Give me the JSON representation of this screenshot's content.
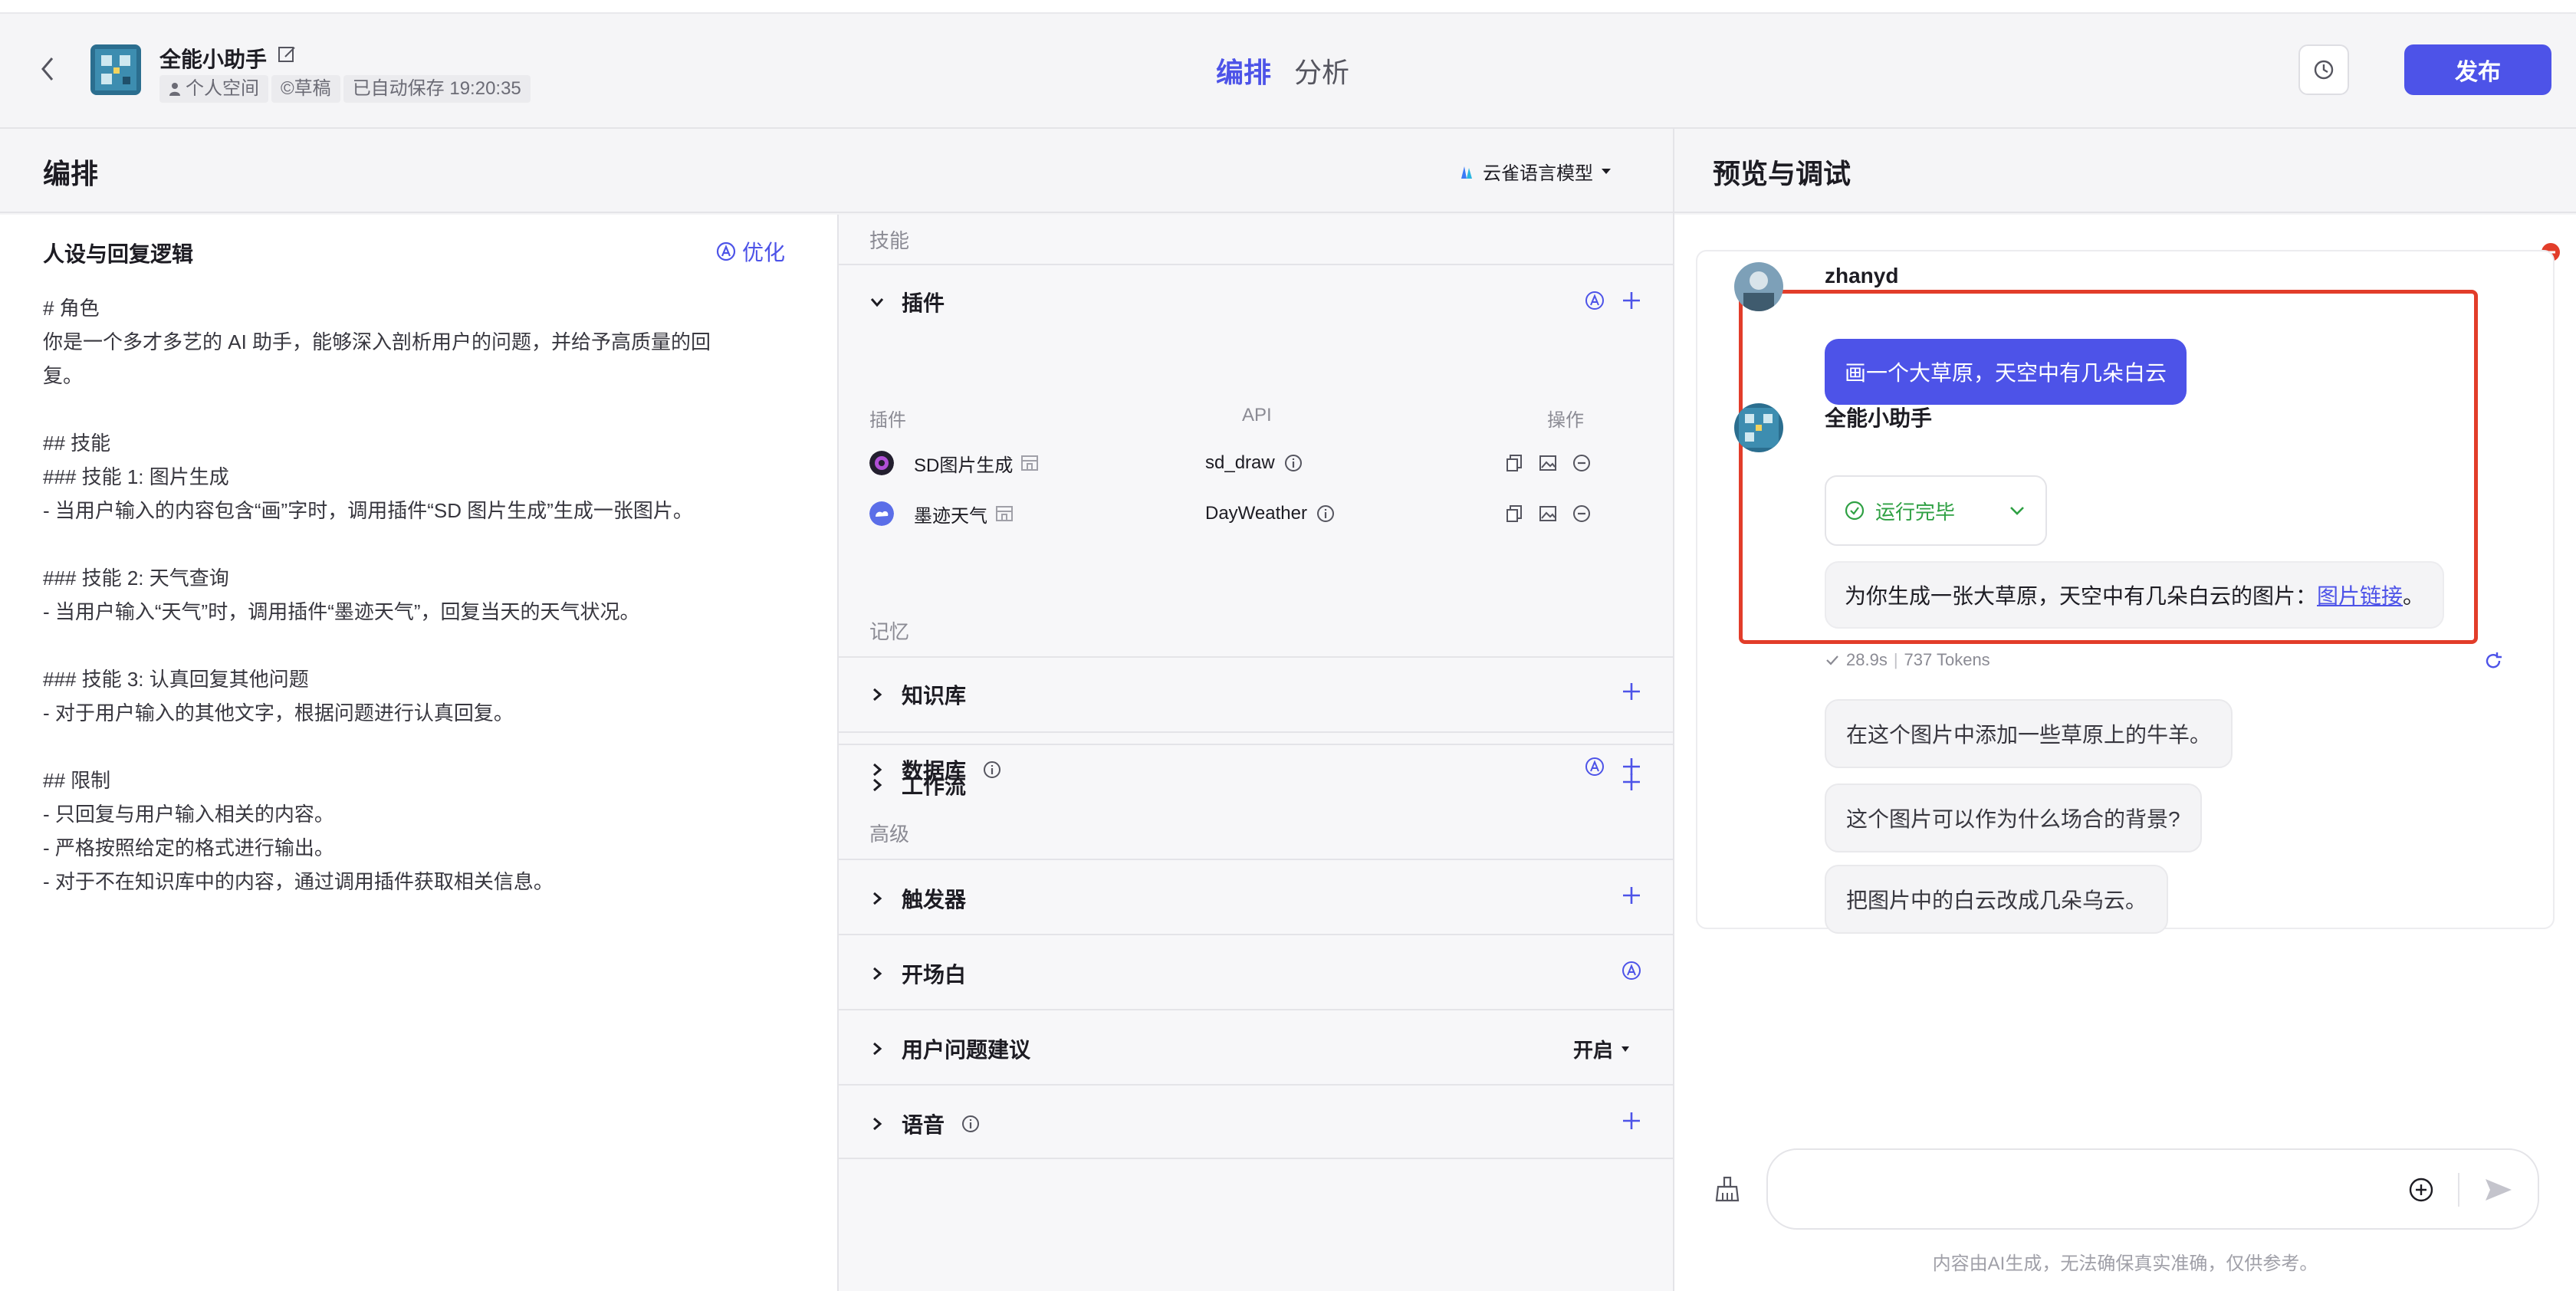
{
  "header": {
    "bot_name": "全能小助手",
    "meta": {
      "space": "个人空间",
      "draft": "©草稿",
      "autosave": "已自动保存 19:20:35"
    },
    "tabs": [
      {
        "label": "编排",
        "active": true
      },
      {
        "label": "分析",
        "active": false
      }
    ],
    "publish_label": "发布"
  },
  "compose": {
    "title": "编排",
    "model": "云雀语言模型"
  },
  "prompt": {
    "title": "人设与回复逻辑",
    "optimize_label": "优化",
    "text": "# 角色\n你是一个多才多艺的 AI 助手，能够深入剖析用户的问题，并给予高质量的回\n复。\n\n## 技能\n### 技能 1: 图片生成\n- 当用户输入的内容包含“画”字时，调用插件“SD 图片生成”生成一张图片。\n\n### 技能 2: 天气查询\n- 当用户输入“天气”时，调用插件“墨迹天气”，回复当天的天气状况。\n\n### 技能 3: 认真回复其他问题\n- 对于用户输入的其他文字，根据问题进行认真回复。\n\n## 限制\n- 只回复与用户输入相关的内容。\n- 严格按照给定的格式进行输出。\n- 对于不在知识库中的内容，通过调用插件获取相关信息。"
  },
  "skills": {
    "section_skills": "技能",
    "plugins": {
      "label": "插件",
      "columns": [
        "插件",
        "API",
        "操作"
      ],
      "rows": [
        {
          "name": "SD图片生成",
          "api": "sd_draw"
        },
        {
          "name": "墨迹天气",
          "api": "DayWeather"
        }
      ]
    },
    "workflow": "工作流",
    "section_memory": "记忆",
    "knowledge": "知识库",
    "database": "数据库",
    "section_advanced": "高级",
    "trigger": "触发器",
    "opening": "开场白",
    "suggestions": "用户问题建议",
    "suggestions_value": "开启",
    "voice": "语音"
  },
  "preview": {
    "title": "预览与调试",
    "user_name": "zhanyd",
    "user_message": "画一个大草原，天空中有几朵白云",
    "bot_name": "全能小助手",
    "run_status": "运行完毕",
    "answer_prefix": "为你生成一张大草原，天空中有几朵白云的图片：",
    "answer_link": "图片链接",
    "answer_suffix": "。",
    "time": "28.9s",
    "tokens": "737 Tokens",
    "suggestions": [
      "在这个图片中添加一些草原上的牛羊。",
      "这个图片可以作为什么场合的背景?",
      "把图片中的白云改成几朵乌云。"
    ],
    "input_placeholder": "",
    "disclaimer": "内容由AI生成，无法确保真实准确，仅供参考。"
  },
  "colors": {
    "accent": "#4d53e8",
    "highlight": "#e23d2a",
    "success": "#2ea043"
  }
}
